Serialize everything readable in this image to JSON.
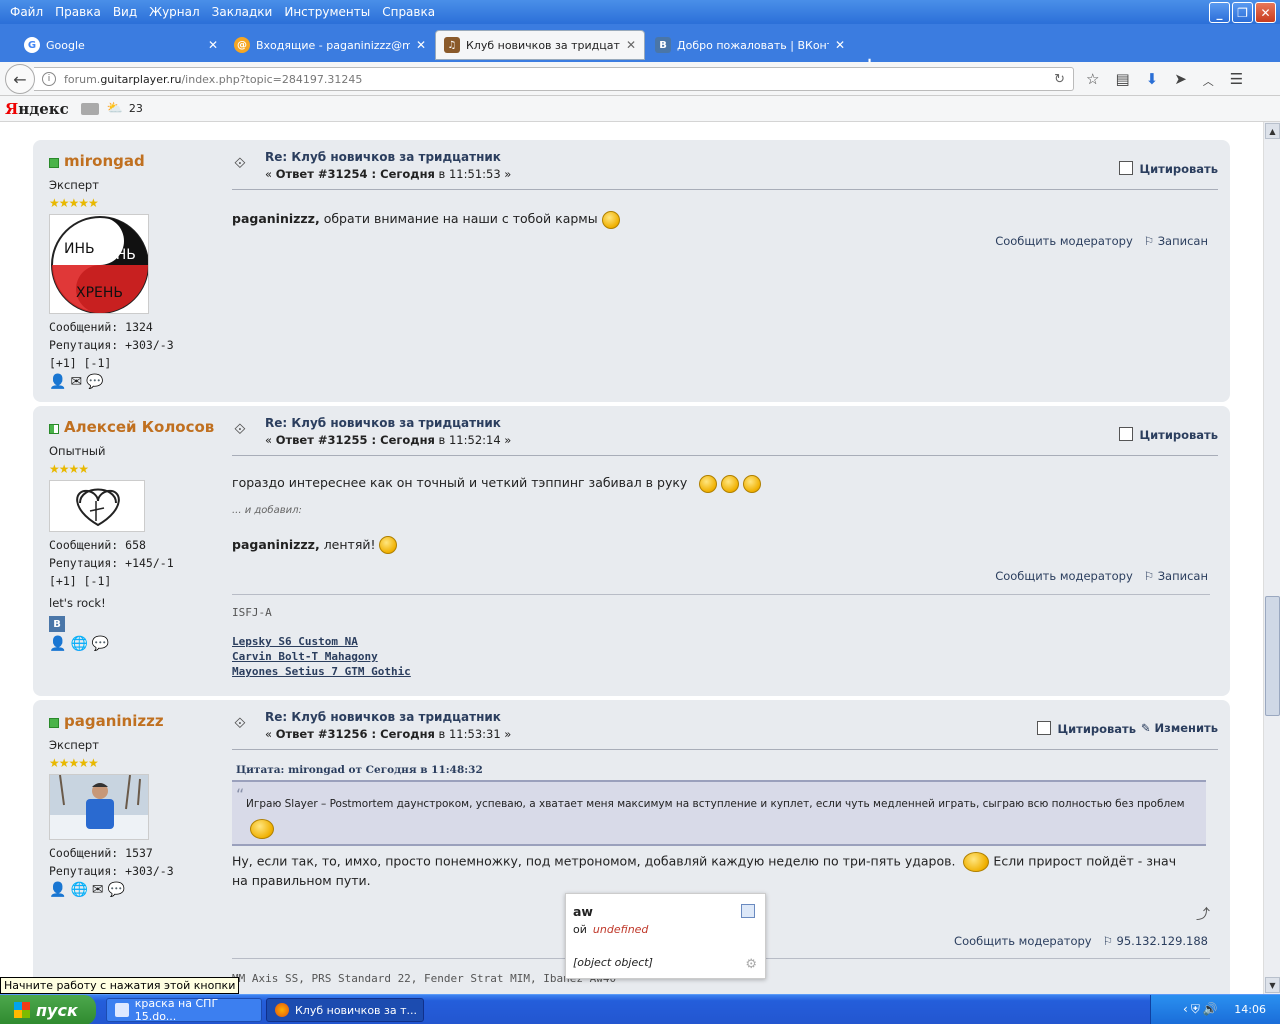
{
  "menubar": {
    "items": [
      "Файл",
      "Правка",
      "Вид",
      "Журнал",
      "Закладки",
      "Инструменты",
      "Справка"
    ]
  },
  "tabs": [
    {
      "label": "Google",
      "icon": "google-icon",
      "icon_text": "G"
    },
    {
      "label": "Входящие - paganinizzz@mai...",
      "icon": "mail-icon",
      "icon_text": "@"
    },
    {
      "label": "Клуб новичков за тридцатн...",
      "icon": "guitar-icon",
      "icon_text": "♫"
    },
    {
      "label": "Добро пожаловать | ВКонт...",
      "icon": "vk-icon",
      "icon_text": "B"
    }
  ],
  "address": {
    "prefix": "forum.",
    "domain": "guitarplayer.ru",
    "path": "/index.php?topic=284197.31245"
  },
  "yandex": {
    "logo_y": "Я",
    "logo_rest": "ндекс",
    "temp": "23"
  },
  "posts": [
    {
      "user": "mirongad",
      "rank": "Эксперт",
      "stars": "★★★★★",
      "messages": "Сообщений: 1324",
      "reputation": "Репутация: +303/-3",
      "vote": "[+1] [-1]",
      "title": "Re: Клуб новичков за тридцатник",
      "meta_pre": "« ",
      "meta_bold": "Ответ #31254 : Сегодня",
      "meta_post": " в 11:51:53 »",
      "quote_label": "Цитировать",
      "text_bold": "paganinizzz,",
      "text": " обрати внимание на наши с тобой кармы",
      "report": "Сообщить модератору",
      "logged": "Записан",
      "avatar_text": [
        "ИНЬ",
        "ЯНЬ",
        "ХРЕНЬ"
      ]
    },
    {
      "user": "Алексей Колосов",
      "rank": "Опытный",
      "stars": "★★★★",
      "messages": "Сообщений: 658",
      "reputation": "Репутация: +145/-1",
      "vote": "[+1] [-1]",
      "personal": "let's rock!",
      "title": "Re: Клуб новичков за тридцатник",
      "meta_pre": "« ",
      "meta_bold": "Ответ #31255 : Сегодня",
      "meta_post": " в 11:52:14 »",
      "quote_label": "Цитировать",
      "text": "гораздо интереснее как он точный и четкий тэппинг забивал в руку",
      "added": "... и добавил:",
      "text2_bold": "paganinizzz,",
      "text2": " лентяй!",
      "report": "Сообщить модератору",
      "logged": "Записан",
      "sig_title": "ISFJ-A",
      "sig_links": [
        "Lepsky S6 Custom NA",
        "Carvin Bolt-T Mahagony",
        "Mayones Setius 7 GTM Gothic"
      ]
    },
    {
      "user": "paganinizzz",
      "rank": "Эксперт",
      "stars": "★★★★★",
      "messages": "Сообщений: 1537",
      "reputation": "Репутация: +303/-3",
      "title": "Re: Клуб новичков за тридцатник",
      "meta_pre": "« ",
      "meta_bold": "Ответ #31256 : Сегодня",
      "meta_post": " в 11:53:31 »",
      "quote_label": "Цитировать",
      "edit_label": "Изменить",
      "quote_head": "Цитата: mirongad от Сегодня в 11:48:32",
      "quote_text": "Играю  Slayer – Postmortem даунстроком, успеваю, а хватает меня максимум на вступление и куплет, если чуть медленней играть, сыграю всю полностью без проблем",
      "text": "Ну, если так, то, имхо, просто понемножку, под метрономом, добавляй каждую неделю по три-пять ударов.",
      "text_after": " Если прирост пойдёт - знач на правильном пути.",
      "report": "Сообщить модератору",
      "ip": "95.132.129.188",
      "sig": "MM Axis SS, PRS Standard 22, Fender Strat MIM, Ibanez Aw40"
    }
  ],
  "popup": {
    "title": "aw",
    "label": "ой",
    "value": "undefined",
    "object": "[object object]"
  },
  "tooltip": "Начните работу с нажатия этой кнопки",
  "taskbar": {
    "start": "пуск",
    "task1": "краска на СПГ 15.do...",
    "task2": "Клуб новичков за т...",
    "lang": "RL",
    "clock": "14:06"
  }
}
